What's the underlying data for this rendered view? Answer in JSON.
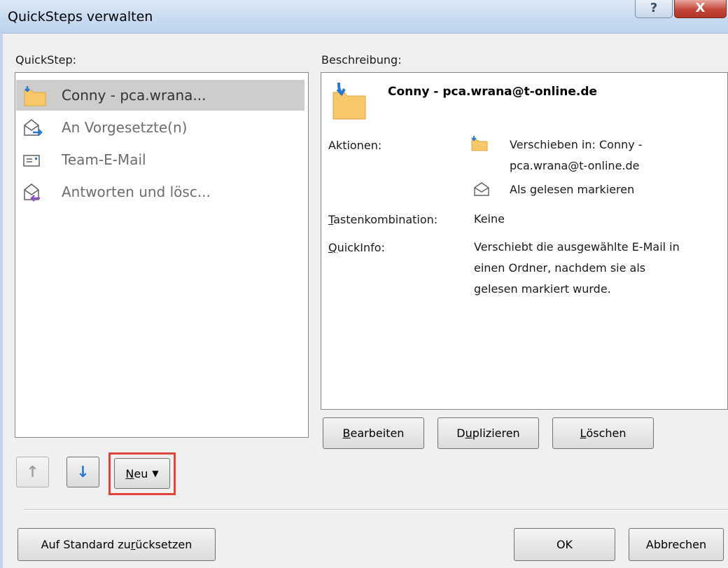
{
  "window": {
    "title": "QuickSteps verwalten",
    "help_label": "?",
    "close_label": "X"
  },
  "quicksteps": {
    "label": "QuickStep:",
    "items": [
      {
        "label": "Conny - pca.wrana...",
        "icon": "folder-move-icon",
        "selected": true
      },
      {
        "label": "An Vorgesetzte(n)",
        "icon": "forward-mail-icon",
        "selected": false
      },
      {
        "label": "Team-E-Mail",
        "icon": "envelope-icon",
        "selected": false
      },
      {
        "label": "Antworten und lösc...",
        "icon": "reply-mail-icon",
        "selected": false
      }
    ]
  },
  "description": {
    "label": "Beschreibung:",
    "title": "Conny - pca.wrana@t-online.de",
    "actions_label": "Aktionen:",
    "actions": [
      {
        "text_line1": "Verschieben in: Conny -",
        "text_line2": "pca.wrana@t-online.de",
        "icon": "folder-move-icon"
      },
      {
        "text_line1": "Als gelesen markieren",
        "icon": "open-envelope-icon"
      }
    ],
    "shortcut_label_pre": "",
    "shortcut_label_ul": "T",
    "shortcut_label_post": "astenkombination:",
    "shortcut_value": "Keine",
    "tooltip_label_ul": "Q",
    "tooltip_label_post": "uickInfo:",
    "tooltip_lines": [
      "Verschiebt die ausgewählte E-Mail in",
      "einen Ordner, nachdem sie als",
      "gelesen markiert wurde."
    ]
  },
  "buttons": {
    "edit_ul": "B",
    "edit_rest": "earbeiten",
    "duplicate_pre": "D",
    "duplicate_ul": "u",
    "duplicate_rest": "plizieren",
    "delete_ul": "L",
    "delete_rest": "öschen",
    "new_ul": "N",
    "new_rest": "eu",
    "up_glyph": "↑",
    "down_glyph": "↓",
    "reset_pre": "Auf Standard zu",
    "reset_ul": "r",
    "reset_rest": "ücksetzen",
    "ok": "OK",
    "cancel": "Abbrechen"
  },
  "colors": {
    "accent_blue": "#2b78d4",
    "folder": "#f6c86a",
    "highlight": "#e0453c"
  }
}
